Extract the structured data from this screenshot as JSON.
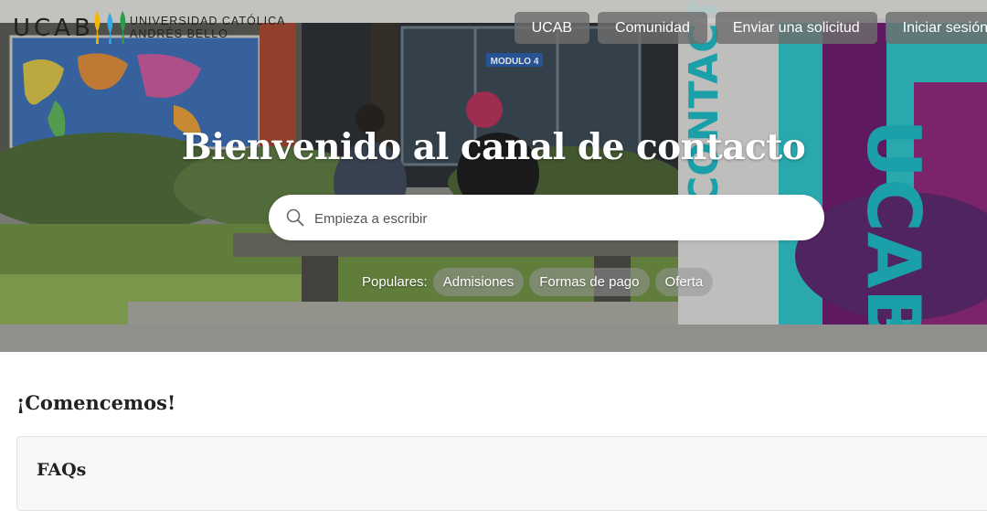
{
  "logo": {
    "wordmark": "UCAB",
    "name_line1": "UNIVERSIDAD CATÓLICA",
    "name_line2": "ANDRÉS BELLO",
    "mark_colors": [
      "#f2b705",
      "#3aa7e0",
      "#2e9a4b"
    ]
  },
  "nav": {
    "items": [
      {
        "label": "UCAB"
      },
      {
        "label": "Comunidad"
      },
      {
        "label": "Enviar una solicitud"
      },
      {
        "label": "Iniciar sesión"
      }
    ]
  },
  "hero": {
    "title": "Bienvenido al canal de contacto",
    "sign_text": "MODULO 4",
    "banner_text": "CONTACTO UCAB"
  },
  "search": {
    "placeholder": "Empieza a escribir",
    "icon": "search-icon"
  },
  "popular": {
    "label": "Populares:",
    "items": [
      {
        "label": "Admisiones"
      },
      {
        "label": "Formas de pago"
      },
      {
        "label": "Oferta"
      }
    ]
  },
  "main": {
    "heading": "¡Comencemos!",
    "faq_title": "FAQs"
  },
  "colors": {
    "accent_teal": "#1fb6c1",
    "accent_purple": "#6b1d6e",
    "nav_bg": "#6e6e6e"
  }
}
